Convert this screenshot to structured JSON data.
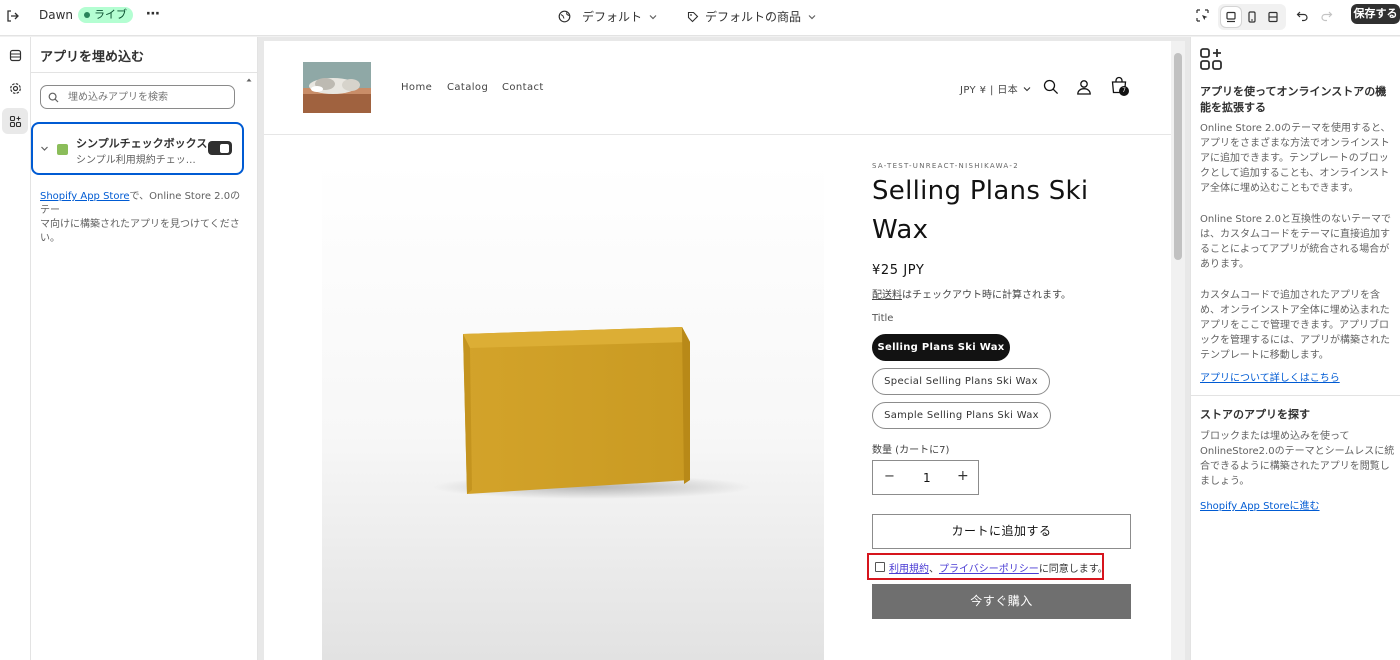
{
  "topbar": {
    "theme_name": "Dawn",
    "status_badge": "ライブ",
    "more_label": "⋯",
    "template_select": "デフォルト",
    "product_select": "デフォルトの商品",
    "save_label": "保存する"
  },
  "left_panel": {
    "title": "アプリを埋め込む",
    "search_placeholder": "埋め込みアプリを検索",
    "app": {
      "name": "シンプルチェックボックス",
      "subtitle": "シンプル利用規約チェッ…",
      "enabled": true
    },
    "footer_link": "Shopify App Store",
    "footer_text_1": "で、Online Store 2.0のテー",
    "footer_text_2": "マ向けに構築されたアプリを見つけてくださ",
    "footer_text_3": "い。"
  },
  "store": {
    "nav": [
      "Home",
      "Catalog",
      "Contact"
    ],
    "currency": "JPY ¥ | 日本",
    "cart_count": "7",
    "vendor": "SA-TEST-UNREACT-NISHIKAWA-2",
    "title_line1": "Selling Plans Ski",
    "title_line2": "Wax",
    "price": "¥25 JPY",
    "shipping_link": "配送料",
    "shipping_text": "はチェックアウト時に計算されます。",
    "option_label": "Title",
    "options": [
      {
        "label": "Selling Plans Ski Wax",
        "selected": true
      },
      {
        "label": "Special Selling Plans Ski Wax",
        "selected": false
      },
      {
        "label": "Sample Selling Plans Ski Wax",
        "selected": false
      }
    ],
    "qty_label": "数量 (カートに7)",
    "qty_value": "1",
    "qty_minus": "−",
    "qty_plus": "+",
    "add_to_cart": "カートに追加する",
    "agree_link1": "利用規約",
    "agree_sep": "、",
    "agree_link2": "プライバシーポリシー",
    "agree_suffix": "に同意します。",
    "buy_now": "今すぐ購入"
  },
  "right_panel": {
    "heading1_line1": "アプリを使ってオンラインストアの機",
    "heading1_line2": "能を拡張する",
    "para1": [
      "Online Store 2.0のテーマを使用すると、",
      "アプリをさまざまな方法でオンラインスト",
      "アに追加できます。テンプレートのブロッ",
      "クとして追加することも、オンラインスト",
      "ア全体に埋め込むこともできます。"
    ],
    "para2": [
      "Online Store 2.0と互換性のないテーマで",
      "は、カスタムコードをテーマに直接追加す",
      "ることによってアプリが統合される場合が",
      "あります。"
    ],
    "para3": [
      "カスタムコードで追加されたアプリを含",
      "め、オンラインストア全体に埋め込まれた",
      "アプリをここで管理できます。アプリブロ",
      "ックを管理するには、アプリが構築された",
      "テンプレートに移動します。"
    ],
    "link1": "アプリについて詳しくはこちら",
    "heading2": "ストアのアプリを探す",
    "para4": [
      "ブロックまたは埋め込みを使って",
      "OnlineStore2.0のテーマとシームレスに統",
      "合できるように構築されたアプリを閲覧し",
      "ましょう。"
    ],
    "link2": "Shopify App Storeに進む"
  },
  "colors": {
    "accent": "#005bd3",
    "live_badge": "#b4fed2",
    "highlight_border": "#d6151d",
    "buy_now": "#6f6f6f"
  }
}
